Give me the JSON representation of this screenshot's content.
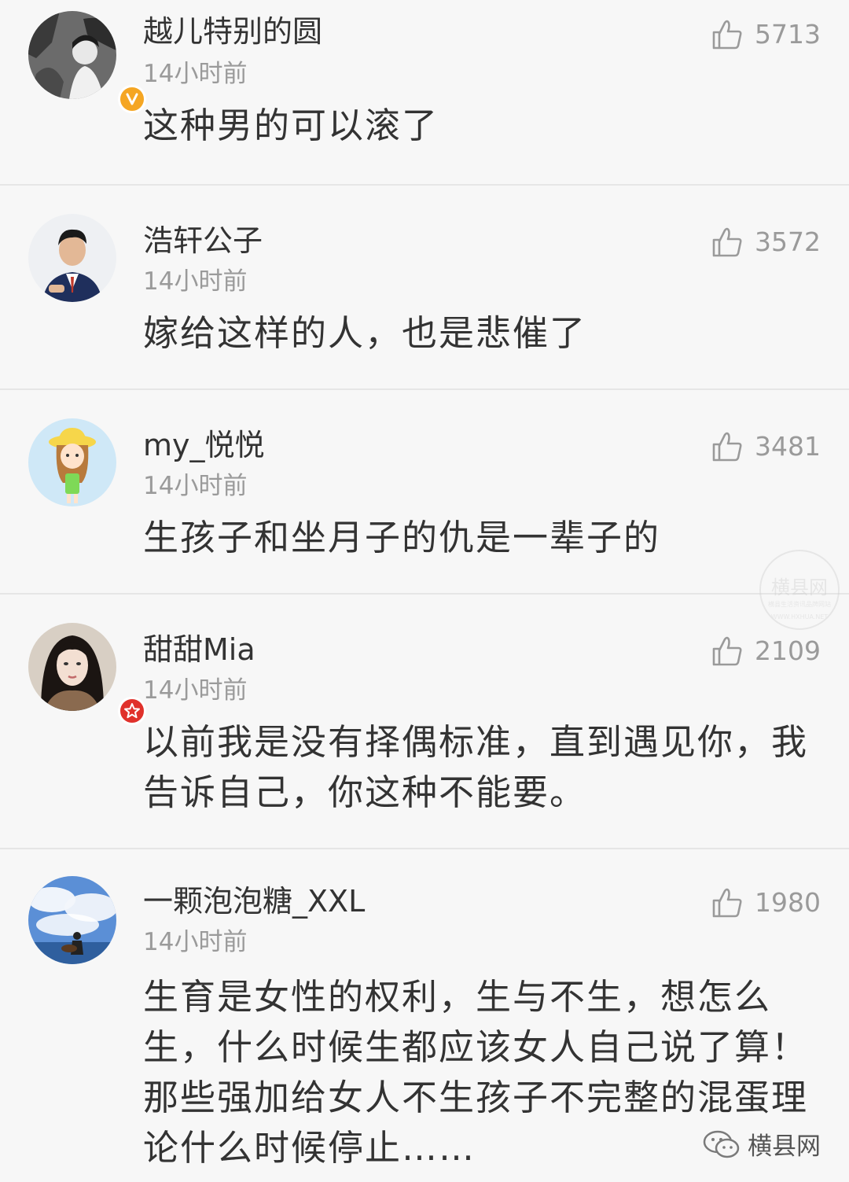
{
  "comments": [
    {
      "username": "越儿特别的圆",
      "time": "14小时前",
      "likes": "5713",
      "text": "这种男的可以滚了",
      "avatar_icon": "woman-bw-photo",
      "badge_icon": "v-verified-badge",
      "badge_color": "#f5a623"
    },
    {
      "username": "浩轩公子",
      "time": "14小时前",
      "likes": "3572",
      "text": "嫁给这样的人，也是悲催了",
      "avatar_icon": "man-suit-photo"
    },
    {
      "username": "my_悦悦",
      "time": "14小时前",
      "likes": "3481",
      "text": "生孩子和坐月子的仇是一辈子的",
      "avatar_icon": "cartoon-girl-hat"
    },
    {
      "username": "甜甜Mia",
      "time": "14小时前",
      "likes": "2109",
      "text": "以前我是没有择偶标准，直到遇见你，我告诉自己，你这种不能要。",
      "avatar_icon": "girl-portrait-photo",
      "badge_icon": "star-badge",
      "badge_color": "#e0312b"
    },
    {
      "username": "一颗泡泡糖_XXL",
      "time": "14小时前",
      "likes": "1980",
      "text": "生育是女性的权利，生与不生，想怎么生，什么时候生都应该女人自己说了算！那些强加给女人不生孩子不完整的混蛋理论什么时候停止……",
      "avatar_icon": "sky-guitar-photo"
    }
  ],
  "watermark": {
    "brand_name": "横县网",
    "stamp_title": "横县网",
    "stamp_subtitle": "横县生活资讯品牌网站",
    "stamp_url": "WWW.HXHUA.NET"
  },
  "colors": {
    "background": "#f7f7f7",
    "text": "#333333",
    "meta": "#9a9a9a"
  }
}
